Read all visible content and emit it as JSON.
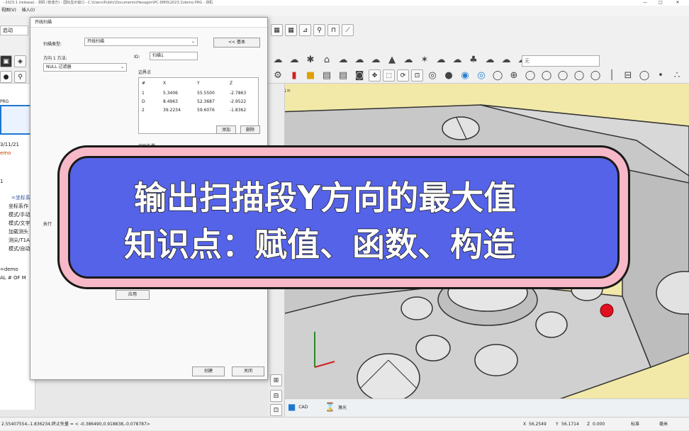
{
  "window": {
    "title": "- 2023.1 (release) - 测机 (普通方) - 国际显示窗口 - C:\\Users\\Public\\Documents\\Hexagon\\PC-DMIS\\2023.1\\demo.PRG - 测机",
    "minimize": "—",
    "maximize": "□",
    "close": "✕"
  },
  "menubar": {
    "items": [
      "视图(V)",
      "插入(I)"
    ]
  },
  "ribbon": {
    "start_tab": "启动",
    "search_placeholder": "无"
  },
  "left_pane": {
    "file_tag": "PRG",
    "date": "3/11/21",
    "demo": "emo",
    "one": "1",
    "lines": [
      "=坐标系",
      "坐标系作",
      "模式/手动",
      "模式/文字",
      "加载测头",
      "测尖/T1A",
      "模式/自动"
    ],
    "footer1": "=demo",
    "footer2": "AL # OF M"
  },
  "dialog": {
    "title": "开线扫描",
    "scan_type_label": "扫描类型:",
    "scan_type_value": "开线扫描",
    "basic_button": "<< 基本",
    "direction_label": "方向 1 方法:",
    "direction_value": "NULL 过滤器",
    "id_label": "ID:",
    "id_value": "扫描1",
    "boundary_label": "边界点",
    "table_headers": [
      "#",
      "X",
      "Y",
      "Z"
    ],
    "table_rows": [
      {
        "id": "1",
        "x": "5.3406",
        "y": "55.5500",
        "z": "-2.7863"
      },
      {
        "id": "D",
        "x": "8.4963",
        "y": "52.3687",
        "z": "-2.9522"
      },
      {
        "id": "2",
        "x": "39.2234",
        "y": "59.6076",
        "z": "-1.8362"
      }
    ],
    "add_button": "添加",
    "delete_button": "删除",
    "init_vector_label": "初始矢量",
    "exec_label": "执行",
    "apply_button": "应用",
    "create_button": "创建",
    "close_button": "关闭"
  },
  "viewport": {
    "v_label": "V1=",
    "tab_cad": "CAD",
    "tab_light": "激光"
  },
  "statusbar": {
    "left": "2.55407554,-1.836234;终止矢量 = < -0.386490,0.918838,-0.078787>",
    "x_label": "X",
    "x_value": "56.2549",
    "y_label": "Y",
    "y_value": "56.1714",
    "z_label": "Z",
    "z_value": "0.000",
    "mode": "毫米",
    "scale": "标准"
  },
  "overlay": {
    "line1": "输出扫描段Y方向的最大值",
    "line2": "知识点：赋值、函数、构造"
  },
  "colors": {
    "overlay_inner": "#5563e8",
    "overlay_outer": "#f7b9c8",
    "viewport_bg": "#f2e9a8",
    "hit_point": "#e01020"
  }
}
